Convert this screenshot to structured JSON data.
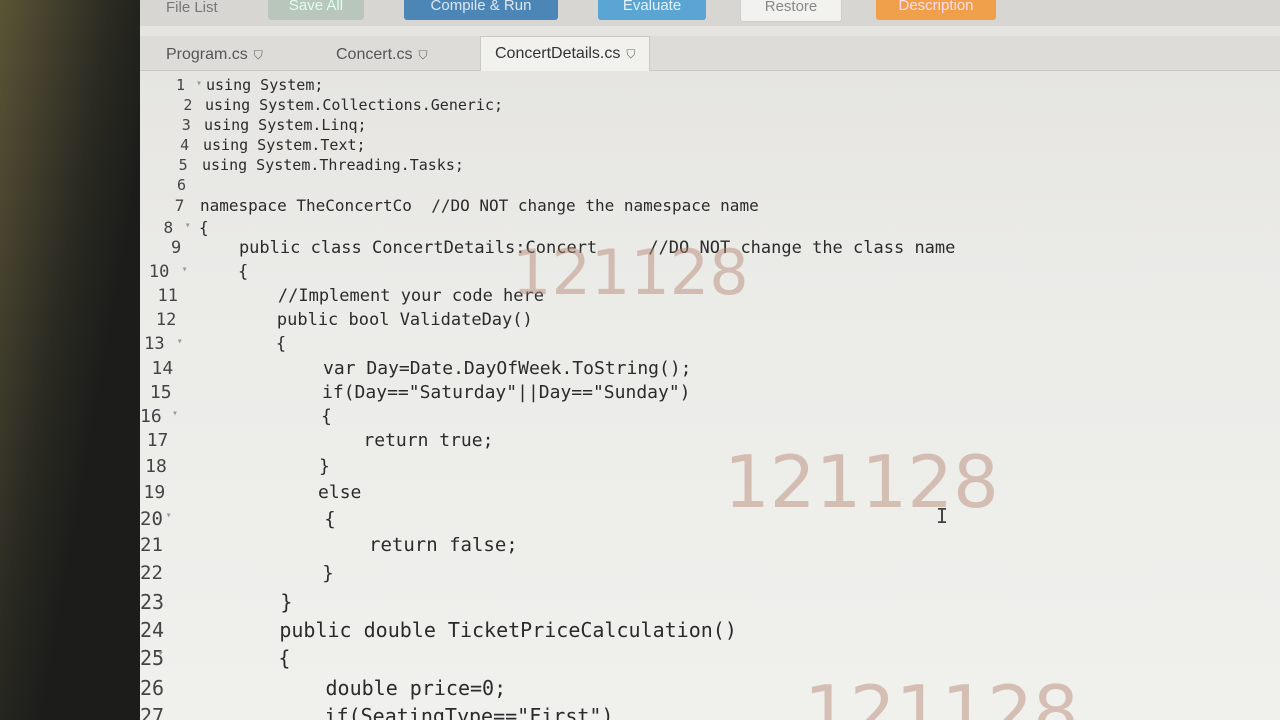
{
  "toolbar": {
    "file_list": "File List",
    "save_all": "Save All",
    "compile_run": "Compile & Run",
    "evaluate": "Evaluate",
    "restore": "Restore",
    "description": "Description"
  },
  "tabs": [
    {
      "label": "Program.cs"
    },
    {
      "label": "Concert.cs"
    },
    {
      "label": "ConcertDetails.cs"
    }
  ],
  "watermark": "121128",
  "code_lines": [
    {
      "n": "1",
      "fold": true,
      "text": "using System;"
    },
    {
      "n": "2",
      "fold": false,
      "text": "using System.Collections.Generic;"
    },
    {
      "n": "3",
      "fold": false,
      "text": "using System.Linq;"
    },
    {
      "n": "4",
      "fold": false,
      "text": "using System.Text;"
    },
    {
      "n": "5",
      "fold": false,
      "text": "using System.Threading.Tasks;"
    },
    {
      "n": "6",
      "fold": false,
      "text": ""
    },
    {
      "n": "7",
      "fold": false,
      "text": "namespace TheConcertCo  //DO NOT change the namespace name"
    },
    {
      "n": "8",
      "fold": true,
      "text": "{"
    },
    {
      "n": "9",
      "fold": false,
      "text": "    public class ConcertDetails:Concert     //DO NOT change the class name"
    },
    {
      "n": "10",
      "fold": true,
      "text": "    {"
    },
    {
      "n": "11",
      "fold": false,
      "text": "        //Implement your code here"
    },
    {
      "n": "12",
      "fold": false,
      "text": "        public bool ValidateDay()"
    },
    {
      "n": "13",
      "fold": true,
      "text": "        {"
    },
    {
      "n": "14",
      "fold": false,
      "text": "            var Day=Date.DayOfWeek.ToString();"
    },
    {
      "n": "15",
      "fold": false,
      "text": "            if(Day==\"Saturday\"||Day==\"Sunday\")"
    },
    {
      "n": "16",
      "fold": true,
      "text": "            {"
    },
    {
      "n": "17",
      "fold": false,
      "text": "                return true;"
    },
    {
      "n": "18",
      "fold": false,
      "text": "            }"
    },
    {
      "n": "19",
      "fold": false,
      "text": "            else"
    },
    {
      "n": "20",
      "fold": true,
      "text": "            {"
    },
    {
      "n": "21",
      "fold": false,
      "text": "                return false;"
    },
    {
      "n": "22",
      "fold": false,
      "text": "            }"
    },
    {
      "n": "23",
      "fold": false,
      "text": "        }"
    },
    {
      "n": "24",
      "fold": false,
      "text": "        public double TicketPriceCalculation()"
    },
    {
      "n": "25",
      "fold": true,
      "text": "        {"
    },
    {
      "n": "26",
      "fold": false,
      "text": "            double price=0;"
    },
    {
      "n": "27",
      "fold": false,
      "text": "            if(SeatingType==\"First\")"
    }
  ]
}
